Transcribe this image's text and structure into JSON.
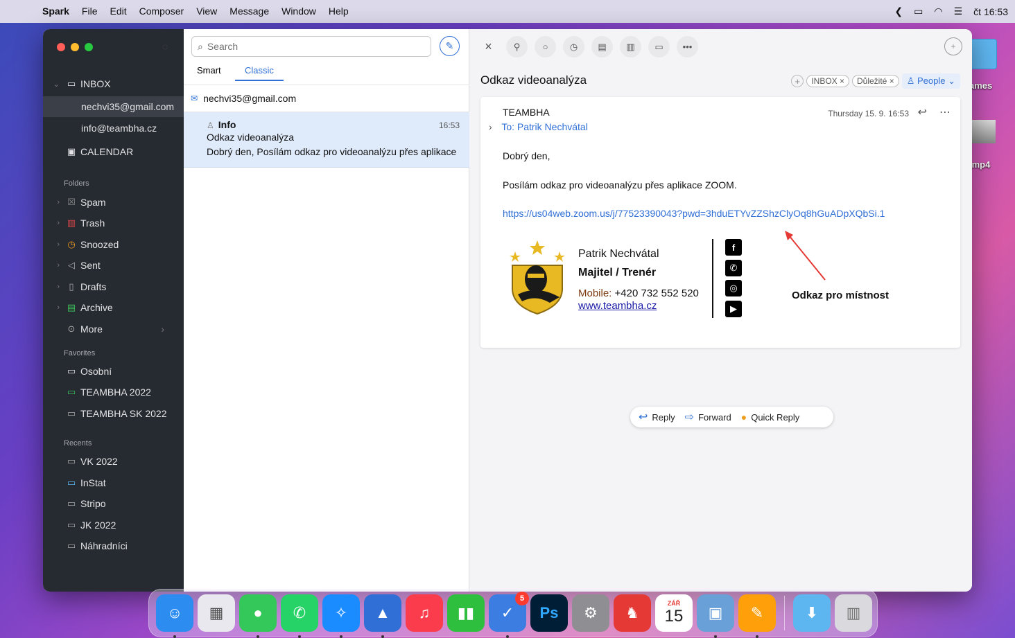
{
  "menubar": {
    "app": "Spark",
    "items": [
      "File",
      "Edit",
      "Composer",
      "View",
      "Message",
      "Window",
      "Help"
    ],
    "clock": "čt 16:53"
  },
  "desktop": {
    "label1": "ames",
    "label2": ".mp4"
  },
  "sidebar": {
    "inbox": "INBOX",
    "accounts": [
      "nechvi35@gmail.com",
      "info@teambha.cz"
    ],
    "calendar": "CALENDAR",
    "folders_header": "Folders",
    "folders": [
      {
        "label": "Spam",
        "icon": "spam-icon"
      },
      {
        "label": "Trash",
        "icon": "trash-icon"
      },
      {
        "label": "Snoozed",
        "icon": "snooze-icon"
      },
      {
        "label": "Sent",
        "icon": "sent-icon"
      },
      {
        "label": "Drafts",
        "icon": "drafts-icon"
      },
      {
        "label": "Archive",
        "icon": "archive-icon"
      },
      {
        "label": "More",
        "icon": "more-icon"
      }
    ],
    "favorites_header": "Favorites",
    "favorites": [
      "Osobní",
      "TEAMBHA 2022",
      "TEAMBHA SK 2022"
    ],
    "recents_header": "Recents",
    "recents": [
      "VK 2022",
      "InStat",
      "Stripo",
      "JK 2022",
      "Náhradníci"
    ]
  },
  "list": {
    "search_placeholder": "Search",
    "tabs": [
      "Smart",
      "Classic"
    ],
    "active_tab": "Classic",
    "account": "nechvi35@gmail.com",
    "item": {
      "sender": "Info",
      "time": "16:53",
      "subject": "Odkaz videoanalýza",
      "preview": "Dobrý den, Posílám odkaz pro videoanalýzu přes aplikace"
    }
  },
  "reader": {
    "subject": "Odkaz videoanalýza",
    "labels": [
      "INBOX ×",
      "Důležité ×"
    ],
    "people": "People",
    "from": "TEAMBHA",
    "to": "To: Patrik Nechvátal",
    "date": "Thursday 15. 9. 16:53",
    "greeting": "Dobrý den,",
    "line1": "Posílám odkaz pro videoanalýzu přes aplikace ZOOM.",
    "link": "https://us04web.zoom.us/j/77523390043?pwd=3hduETYvZZShzClyOq8hGuADpXQbSi.1",
    "signature": {
      "name": "Patrik Nechvátal",
      "role": "Majitel / Trenér",
      "mobile_label": "Mobile:",
      "mobile": "+420 732 552 520",
      "web": "www.teambha.cz",
      "social": [
        "f",
        "w",
        "ig",
        "yt"
      ]
    },
    "annotation": "Odkaz pro místnost",
    "actions": {
      "reply": "Reply",
      "forward": "Forward",
      "quick_reply": "Quick Reply"
    }
  },
  "dock": {
    "apps": [
      {
        "name": "Finder",
        "color": "#2d8cf0"
      },
      {
        "name": "Launchpad",
        "color": "#e8e8ee"
      },
      {
        "name": "Messages",
        "color": "#34c759"
      },
      {
        "name": "WhatsApp",
        "color": "#25d366"
      },
      {
        "name": "Safari",
        "color": "#1a8cff"
      },
      {
        "name": "Spark",
        "color": "#2f6fd6"
      },
      {
        "name": "Music",
        "color": "#fa3c4c"
      },
      {
        "name": "Numbers",
        "color": "#2fbf3f"
      },
      {
        "name": "Tasks",
        "color": "#3b7de0",
        "badge": "5"
      },
      {
        "name": "Photoshop",
        "color": "#001e36",
        "text": "Ps"
      },
      {
        "name": "System Preferences",
        "color": "#8e8e93"
      },
      {
        "name": "App",
        "color": "#e53935"
      },
      {
        "name": "Calendar",
        "color": "#ffffff",
        "month": "ZÁŘ",
        "day": "15"
      },
      {
        "name": "Preview",
        "color": "#6aa0d8"
      },
      {
        "name": "Pages",
        "color": "#ff9f0a"
      },
      {
        "name": "Downloads",
        "color": "#5eb6f0"
      },
      {
        "name": "Trash",
        "color": "#d9d9de"
      }
    ]
  }
}
